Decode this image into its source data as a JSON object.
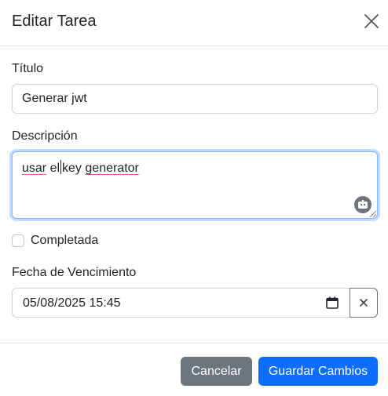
{
  "modal": {
    "title": "Editar Tarea",
    "close_icon": "close-icon"
  },
  "form": {
    "title_label": "Título",
    "title_value": "Generar jwt",
    "description_label": "Descripción",
    "description_parts": {
      "word1": "usar",
      "word2": " el",
      "rest_before": " ",
      "word3": "key",
      "space": " ",
      "word4": "generator"
    },
    "assist_icon": "robot-icon",
    "completed_label": "Completada",
    "completed_checked": false,
    "due_label": "Fecha de Vencimiento",
    "due_value": "05/08/2025 15:45",
    "calendar_icon": "calendar-icon",
    "clear_icon": "x-icon"
  },
  "footer": {
    "cancel_label": "Cancelar",
    "save_label": "Guardar Cambios"
  },
  "colors": {
    "primary": "#0d6efd",
    "secondary": "#6c757d",
    "border": "#dee2e6"
  }
}
